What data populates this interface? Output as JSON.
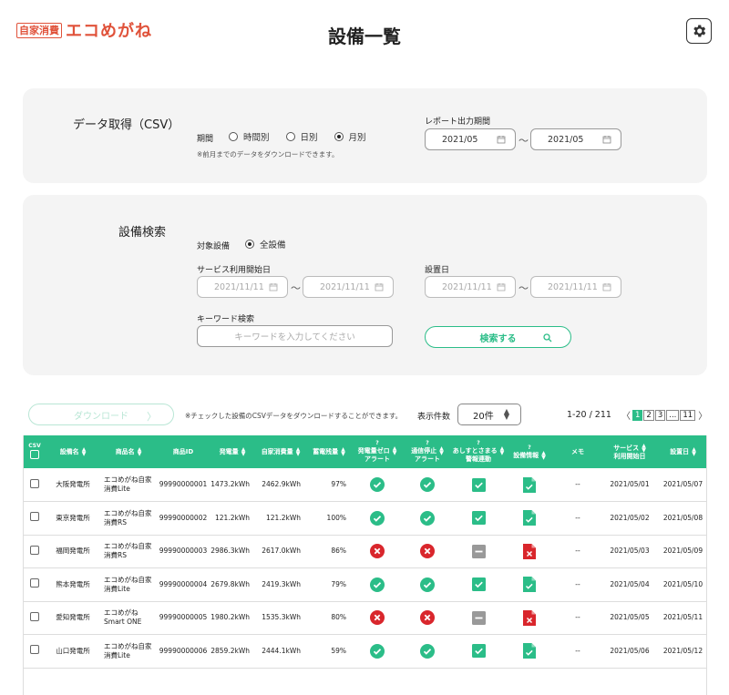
{
  "header": {
    "logo_badge": "自家消費",
    "logo_text": "エコめがね",
    "title": "設備一覧"
  },
  "csv_panel": {
    "heading": "データ取得（CSV）",
    "period_label": "期間",
    "period_options": [
      "時間別",
      "日別",
      "月別"
    ],
    "period_selected": "月別",
    "note": "※前月までのデータをダウンロードできます。",
    "report_label": "レポート出力期間",
    "report_from": "2021/05",
    "report_to": "2021/05",
    "tilde": "〜"
  },
  "search_panel": {
    "heading": "設備検索",
    "target_label": "対象設備",
    "target_option": "全設備",
    "service_start_label": "サービス利用開始日",
    "service_from": "2021/11/11",
    "service_to": "2021/11/11",
    "install_label": "設置日",
    "install_from": "2021/11/11",
    "install_to": "2021/11/11",
    "keyword_label": "キーワード検索",
    "keyword_placeholder": "キーワードを入力してください",
    "search_button": "検索する",
    "tilde": "〜"
  },
  "list_controls": {
    "download_button": "ダウンロード",
    "download_arrow": "〉",
    "download_note": "※チェックした設備のCSVデータをダウンロードすることができます。",
    "count_label": "表示件数",
    "count_value": "20件",
    "range": "1-20 / 211",
    "pages": [
      "1",
      "2",
      "3",
      "...",
      "11"
    ],
    "prev": "〈",
    "next": "〉"
  },
  "table": {
    "columns": {
      "csv": "CSV",
      "name": "設備名",
      "product": "商品名",
      "product_id": "商品ID",
      "generation": "発電量",
      "consumption": "自家消費量",
      "battery": "蓄電残量",
      "gen_zero_alert_1": "発電量ゼロ",
      "gen_zero_alert_2": "アラート",
      "comm_stop_alert_1": "通信停止",
      "comm_stop_alert_2": "アラート",
      "alert_link_1": "あしすとさまる",
      "alert_link_2": "警報連動",
      "device_info": "設備情報",
      "memo": "メモ",
      "service_start_1": "サービス",
      "service_start_2": "利用開始日",
      "install_date": "設置日",
      "help": "?"
    },
    "rows": [
      {
        "name": "大阪発電所",
        "product": "エコめがね自家消費Lite",
        "product_id": "99990000001",
        "generation": "1473.2kWh",
        "consumption": "2462.9kWh",
        "battery": "97%",
        "gen_alert": "ok",
        "comm_alert": "ok",
        "link": "on",
        "info": "ok",
        "memo": "--",
        "service_start": "2021/05/01",
        "install_date": "2021/05/07"
      },
      {
        "name": "東京発電所",
        "product": "エコめがね自家消費RS",
        "product_id": "99990000002",
        "generation": "121.2kWh",
        "consumption": "121.2kWh",
        "battery": "100%",
        "gen_alert": "ok",
        "comm_alert": "ok",
        "link": "on",
        "info": "ok",
        "memo": "--",
        "service_start": "2021/05/02",
        "install_date": "2021/05/08"
      },
      {
        "name": "福岡発電所",
        "product": "エコめがね自家消費RS",
        "product_id": "99990000003",
        "generation": "2986.3kWh",
        "consumption": "2617.0kWh",
        "battery": "86%",
        "gen_alert": "ng",
        "comm_alert": "ng",
        "link": "off",
        "info": "ng",
        "memo": "--",
        "service_start": "2021/05/03",
        "install_date": "2021/05/09"
      },
      {
        "name": "熊本発電所",
        "product": "エコめがね自家消費Lite",
        "product_id": "99990000004",
        "generation": "2679.8kWh",
        "consumption": "2419.3kWh",
        "battery": "79%",
        "gen_alert": "ok",
        "comm_alert": "ok",
        "link": "on",
        "info": "ok",
        "memo": "--",
        "service_start": "2021/05/04",
        "install_date": "2021/05/10"
      },
      {
        "name": "愛知発電所",
        "product": "エコめがねSmart ONE",
        "product_id": "99990000005",
        "generation": "1980.2kWh",
        "consumption": "1535.3kWh",
        "battery": "80%",
        "gen_alert": "ng",
        "comm_alert": "ng",
        "link": "off",
        "info": "ng",
        "memo": "--",
        "service_start": "2021/05/05",
        "install_date": "2021/05/11"
      },
      {
        "name": "山口発電所",
        "product": "エコめがね自家消費Lite",
        "product_id": "99990000006",
        "generation": "2859.2kWh",
        "consumption": "2444.1kWh",
        "battery": "59%",
        "gen_alert": "ok",
        "comm_alert": "ok",
        "link": "on",
        "info": "ok",
        "memo": "--",
        "service_start": "2021/05/06",
        "install_date": "2021/05/12"
      }
    ]
  },
  "colors": {
    "brand": "#e0523a",
    "accent": "#2bbd88",
    "error": "#d9262c",
    "disabled": "#999999"
  }
}
